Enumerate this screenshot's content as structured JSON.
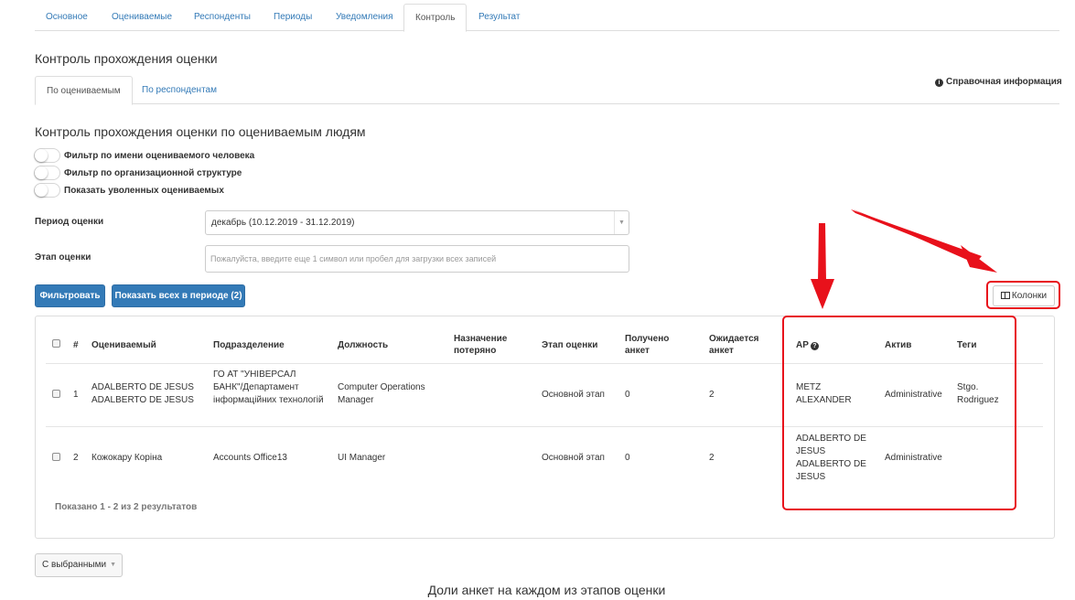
{
  "top_tabs": [
    {
      "label": "Основное"
    },
    {
      "label": "Оцениваемые"
    },
    {
      "label": "Респонденты"
    },
    {
      "label": "Периоды"
    },
    {
      "label": "Уведомления"
    },
    {
      "label": "Контроль",
      "active": true
    },
    {
      "label": "Результат"
    }
  ],
  "section_title": "Контроль прохождения оценки",
  "sub_tabs": [
    {
      "label": "По оцениваемым",
      "active": true
    },
    {
      "label": "По респондентам"
    }
  ],
  "reference_info": {
    "label": "Справочная информация",
    "icon": "info-icon"
  },
  "subsection_title": "Контроль прохождения оценки по оцениваемым людям",
  "filters": {
    "toggles": [
      {
        "label": "Фильтр по имени оцениваемого человека",
        "on": false
      },
      {
        "label": "Фильтр по организационной структуре",
        "on": false
      },
      {
        "label": "Показать уволенных оцениваемых",
        "on": false
      }
    ],
    "period_label": "Период оценки",
    "period_value": "декабрь (10.12.2019 - 31.12.2019)",
    "stage_label": "Этап оценки",
    "stage_placeholder": "Пожалуйста, введите еще 1 символ или пробел для загрузки всех записей",
    "filter_button": "Фильтровать",
    "show_all_button": "Показать всех в периоде (2)",
    "columns_button": "Колонки"
  },
  "table": {
    "headers": {
      "num": "#",
      "evaluated": "Оцениваемый",
      "department": "Подразделение",
      "position": "Должность",
      "assignment_lost": "Назначение потеряно",
      "stage": "Этап оценки",
      "received": "Получено анкет",
      "expected": "Ожидается анкет",
      "ap": "AP",
      "asset": "Актив",
      "tags": "Теги"
    },
    "rows": [
      {
        "num": "1",
        "evaluated": "ADALBERTO DE JESUS ADALBERTO DE JESUS",
        "department": "ГО АТ \"УНІВЕРСАЛ БАНК\"/Департамент інформаційних технологій",
        "position": "Computer Operations Manager",
        "assignment_lost": "",
        "stage": "Основной этап",
        "received": "0",
        "expected": "2",
        "ap": "METZ ALEXANDER",
        "asset": "Administrative",
        "tags": "Stgo. Rodriguez"
      },
      {
        "num": "2",
        "evaluated": "Кожокару Коріна",
        "department": "Accounts Office13",
        "position": "UI Manager",
        "assignment_lost": "",
        "stage": "Основной этап",
        "received": "0",
        "expected": "2",
        "ap": "ADALBERTO DE JESUS ADALBERTO DE JESUS",
        "asset": "Administrative",
        "tags": ""
      }
    ],
    "summary": "Показано 1 - 2 из 2 результатов"
  },
  "bulk_action": {
    "label": "С выбранными"
  },
  "bottom_heading": "Доли анкет на каждом из этапов оценки",
  "colors": {
    "link": "#337ab7",
    "primary": "#337ab7",
    "annotation": "#e8111b"
  }
}
